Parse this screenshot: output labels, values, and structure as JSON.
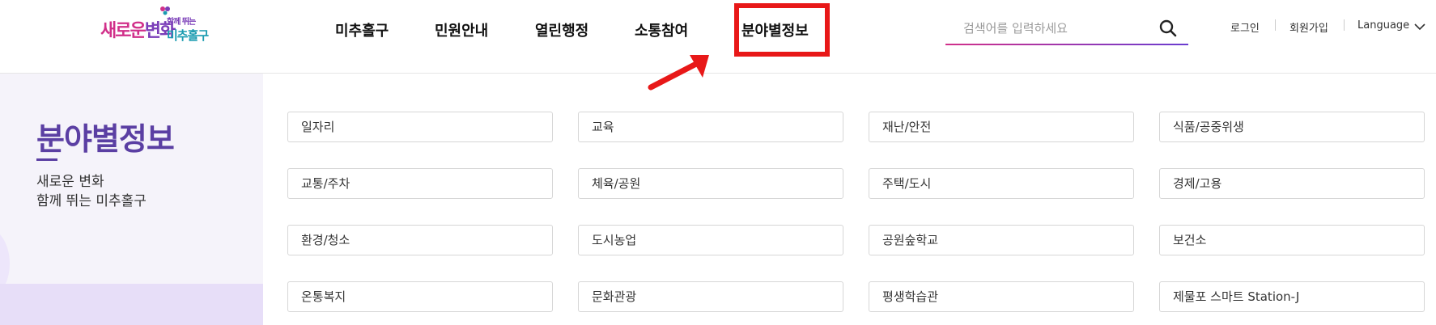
{
  "logo": {
    "text_main_1": "새로운",
    "text_main_2": "변화",
    "text_small": "함께 뛰는",
    "text_district": "미추홀구"
  },
  "nav": {
    "items": [
      {
        "label": "미추홀구"
      },
      {
        "label": "민원안내"
      },
      {
        "label": "열린행정"
      },
      {
        "label": "소통참여"
      },
      {
        "label": "분야별정보"
      }
    ]
  },
  "search": {
    "placeholder": "검색어를 입력하세요",
    "value": ""
  },
  "util": {
    "login": "로그인",
    "signup": "회원가입",
    "language": "Language"
  },
  "sidebar": {
    "title": "분야별정보",
    "slogan_line1": "새로운 변화",
    "slogan_line2": "함께 뛰는 미추홀구"
  },
  "categories": [
    "일자리",
    "교육",
    "재난/안전",
    "식품/공중위생",
    "교통/주차",
    "체육/공원",
    "주택/도시",
    "경제/고용",
    "환경/청소",
    "도시농업",
    "공원숲학교",
    "보건소",
    "온통복지",
    "문화관광",
    "평생학습관",
    "제물포 스마트 Station-J"
  ],
  "colors": {
    "accent_purple": "#5b3fa3",
    "highlight_red": "#e81818",
    "brand_pink": "#d1308a",
    "brand_teal": "#1a9bb0"
  }
}
